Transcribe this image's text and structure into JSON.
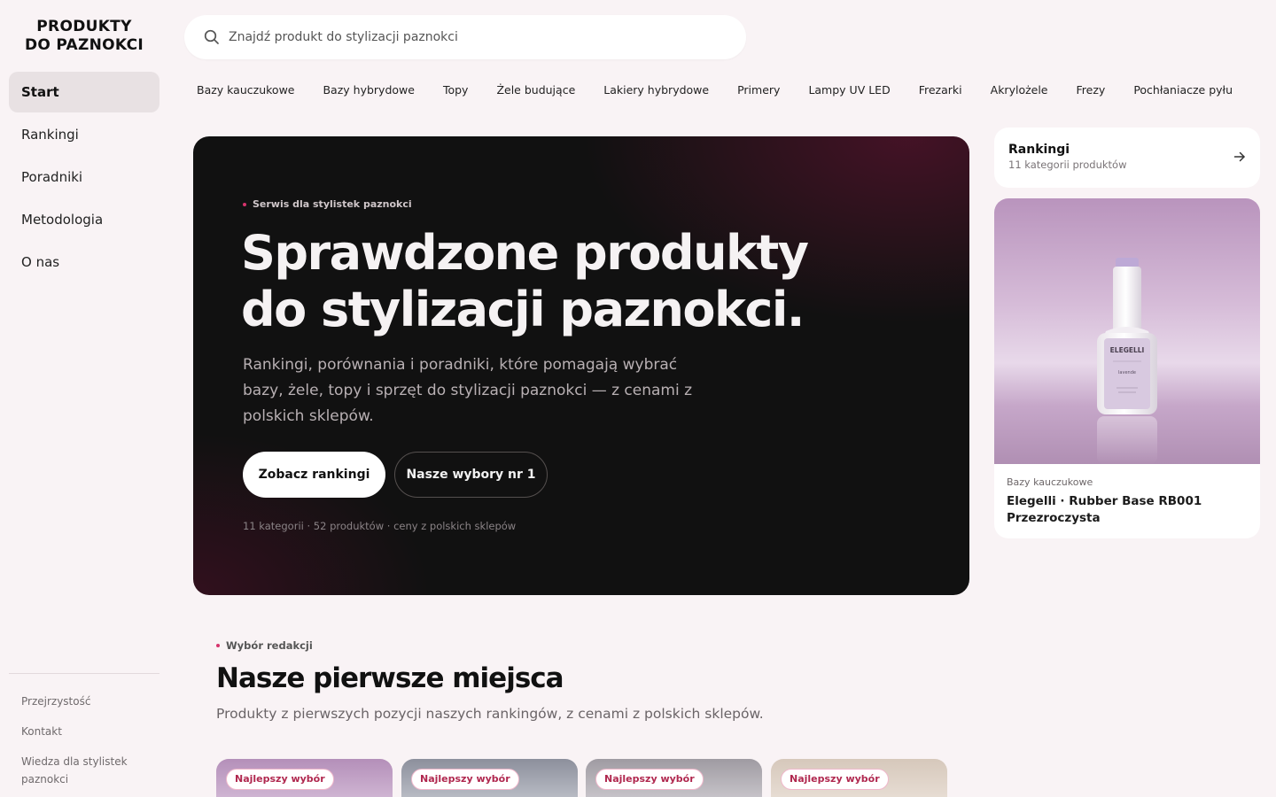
{
  "logo": {
    "line1": "PRODUKTY",
    "line2": "DO PAZNOKCI"
  },
  "nav": [
    {
      "label": "Start",
      "active": true
    },
    {
      "label": "Rankingi"
    },
    {
      "label": "Poradniki"
    },
    {
      "label": "Metodologia"
    },
    {
      "label": "O nas"
    }
  ],
  "footer_links": [
    "Przejrzystość",
    "Kontakt",
    "Wiedza dla stylistek paznokci"
  ],
  "search": {
    "placeholder": "Znajdź produkt do stylizacji paznokci",
    "icon": "search-icon"
  },
  "categories": [
    "Bazy kauczukowe",
    "Bazy hybrydowe",
    "Topy",
    "Żele budujące",
    "Lakiery hybrydowe",
    "Primery",
    "Lampy UV LED",
    "Frezarki",
    "Akrylożele",
    "Frezy",
    "Pochłaniacze pyłu"
  ],
  "hero": {
    "eyebrow": "Serwis dla stylistek paznokci",
    "title_line1": "Sprawdzone produkty",
    "title_line2": "do stylizacji paznokci.",
    "description": "Rankingi, porównania i poradniki, które pomagają wybrać bazy, żele, topy i sprzęt do stylizacji paznokci — z cenami z polskich sklepów.",
    "primary_button": "Zobacz rankingi",
    "secondary_button": "Nasze wybory nr 1",
    "meta": "11 kategorii · 52 produktów · ceny z polskich sklepów"
  },
  "rankings_card": {
    "title": "Rankingi",
    "subtitle": "11 kategorii produktów",
    "icon": "arrow-right-icon"
  },
  "featured_product": {
    "category": "Bazy kauczukowe",
    "name": "Elegelli · Rubber Base RB001 Przezroczysta",
    "bottle_brand": "ELEGELLI",
    "bottle_variant": "lavende"
  },
  "editorial": {
    "eyebrow": "Wybór redakcji",
    "title": "Nasze pierwsze miejsca",
    "description": "Produkty z pierwszych pozycji naszych rankingów, z cenami z polskich sklepów.",
    "cards": [
      {
        "badge": "Najlepszy wybór"
      },
      {
        "badge": "Najlepszy wybór"
      },
      {
        "badge": "Najlepszy wybór"
      },
      {
        "badge": "Najlepszy wybór"
      }
    ]
  },
  "colors": {
    "background": "#f9f3f5",
    "hero": "#111111",
    "accent": "#d6336c",
    "badge_text": "#b0284f"
  }
}
